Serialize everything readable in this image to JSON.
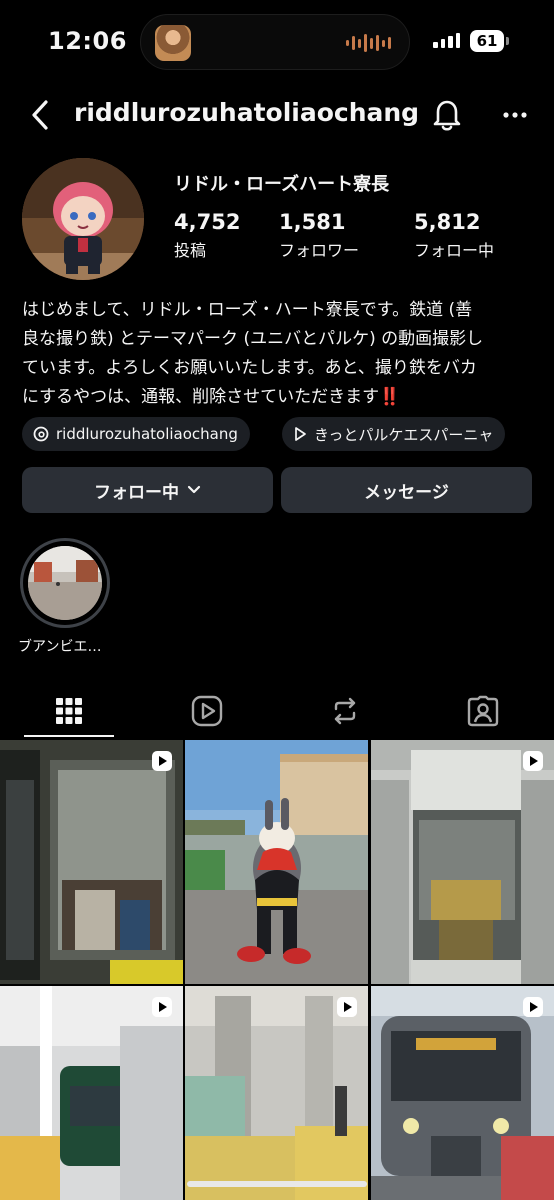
{
  "status_bar": {
    "time": "12:06",
    "battery": "61"
  },
  "header": {
    "username": "riddlurozuhatoliaochang"
  },
  "profile": {
    "display_name": "リドル・ローズハート寮長",
    "stats": [
      {
        "value": "4,752",
        "label": "投稿"
      },
      {
        "value": "1,581",
        "label": "フォロワー"
      },
      {
        "value": "5,812",
        "label": "フォロー中"
      }
    ],
    "bio_lines": [
      "はじめまして、リドル・ローズ・ハート寮長です。鉄道 (善",
      "良な撮り鉄) とテーマパーク (ユニバとパルケ) の動画撮影し",
      "ています。よろしくお願いいたします。あと、撮り鉄をバカ",
      "にするやつは、通報、削除させていただきます‼️"
    ],
    "threads_chip": "riddlurozuhatoliaochang",
    "music_chip": "きっとパルケエスパーニャ"
  },
  "actions": {
    "following_label": "フォロー中",
    "message_label": "メッセージ"
  },
  "highlights": [
    {
      "label": "ブアンビエ…"
    }
  ],
  "tabs": [
    {
      "icon": "grid-icon",
      "active": true
    },
    {
      "icon": "reels-icon",
      "active": false
    },
    {
      "icon": "reposts-icon",
      "active": false
    },
    {
      "icon": "tagged-icon",
      "active": false
    }
  ],
  "colors": {
    "background": "#000000",
    "button": "#2b2f36",
    "chip": "#1c1f24",
    "text": "#f5f5f5"
  }
}
